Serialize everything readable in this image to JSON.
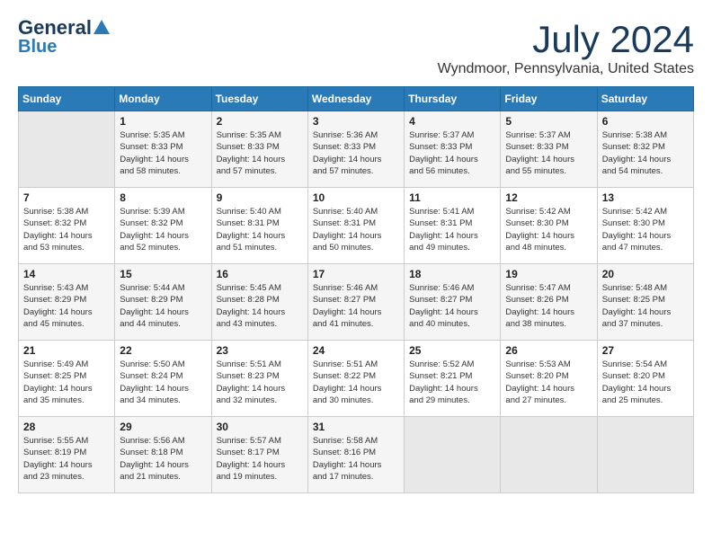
{
  "header": {
    "logo_line1": "General",
    "logo_line2": "Blue",
    "month": "July 2024",
    "location": "Wyndmoor, Pennsylvania, United States"
  },
  "weekdays": [
    "Sunday",
    "Monday",
    "Tuesday",
    "Wednesday",
    "Thursday",
    "Friday",
    "Saturday"
  ],
  "weeks": [
    [
      {
        "day": "",
        "sunrise": "",
        "sunset": "",
        "daylight": ""
      },
      {
        "day": "1",
        "sunrise": "Sunrise: 5:35 AM",
        "sunset": "Sunset: 8:33 PM",
        "daylight": "Daylight: 14 hours and 58 minutes."
      },
      {
        "day": "2",
        "sunrise": "Sunrise: 5:35 AM",
        "sunset": "Sunset: 8:33 PM",
        "daylight": "Daylight: 14 hours and 57 minutes."
      },
      {
        "day": "3",
        "sunrise": "Sunrise: 5:36 AM",
        "sunset": "Sunset: 8:33 PM",
        "daylight": "Daylight: 14 hours and 57 minutes."
      },
      {
        "day": "4",
        "sunrise": "Sunrise: 5:37 AM",
        "sunset": "Sunset: 8:33 PM",
        "daylight": "Daylight: 14 hours and 56 minutes."
      },
      {
        "day": "5",
        "sunrise": "Sunrise: 5:37 AM",
        "sunset": "Sunset: 8:33 PM",
        "daylight": "Daylight: 14 hours and 55 minutes."
      },
      {
        "day": "6",
        "sunrise": "Sunrise: 5:38 AM",
        "sunset": "Sunset: 8:32 PM",
        "daylight": "Daylight: 14 hours and 54 minutes."
      }
    ],
    [
      {
        "day": "7",
        "sunrise": "Sunrise: 5:38 AM",
        "sunset": "Sunset: 8:32 PM",
        "daylight": "Daylight: 14 hours and 53 minutes."
      },
      {
        "day": "8",
        "sunrise": "Sunrise: 5:39 AM",
        "sunset": "Sunset: 8:32 PM",
        "daylight": "Daylight: 14 hours and 52 minutes."
      },
      {
        "day": "9",
        "sunrise": "Sunrise: 5:40 AM",
        "sunset": "Sunset: 8:31 PM",
        "daylight": "Daylight: 14 hours and 51 minutes."
      },
      {
        "day": "10",
        "sunrise": "Sunrise: 5:40 AM",
        "sunset": "Sunset: 8:31 PM",
        "daylight": "Daylight: 14 hours and 50 minutes."
      },
      {
        "day": "11",
        "sunrise": "Sunrise: 5:41 AM",
        "sunset": "Sunset: 8:31 PM",
        "daylight": "Daylight: 14 hours and 49 minutes."
      },
      {
        "day": "12",
        "sunrise": "Sunrise: 5:42 AM",
        "sunset": "Sunset: 8:30 PM",
        "daylight": "Daylight: 14 hours and 48 minutes."
      },
      {
        "day": "13",
        "sunrise": "Sunrise: 5:42 AM",
        "sunset": "Sunset: 8:30 PM",
        "daylight": "Daylight: 14 hours and 47 minutes."
      }
    ],
    [
      {
        "day": "14",
        "sunrise": "Sunrise: 5:43 AM",
        "sunset": "Sunset: 8:29 PM",
        "daylight": "Daylight: 14 hours and 45 minutes."
      },
      {
        "day": "15",
        "sunrise": "Sunrise: 5:44 AM",
        "sunset": "Sunset: 8:29 PM",
        "daylight": "Daylight: 14 hours and 44 minutes."
      },
      {
        "day": "16",
        "sunrise": "Sunrise: 5:45 AM",
        "sunset": "Sunset: 8:28 PM",
        "daylight": "Daylight: 14 hours and 43 minutes."
      },
      {
        "day": "17",
        "sunrise": "Sunrise: 5:46 AM",
        "sunset": "Sunset: 8:27 PM",
        "daylight": "Daylight: 14 hours and 41 minutes."
      },
      {
        "day": "18",
        "sunrise": "Sunrise: 5:46 AM",
        "sunset": "Sunset: 8:27 PM",
        "daylight": "Daylight: 14 hours and 40 minutes."
      },
      {
        "day": "19",
        "sunrise": "Sunrise: 5:47 AM",
        "sunset": "Sunset: 8:26 PM",
        "daylight": "Daylight: 14 hours and 38 minutes."
      },
      {
        "day": "20",
        "sunrise": "Sunrise: 5:48 AM",
        "sunset": "Sunset: 8:25 PM",
        "daylight": "Daylight: 14 hours and 37 minutes."
      }
    ],
    [
      {
        "day": "21",
        "sunrise": "Sunrise: 5:49 AM",
        "sunset": "Sunset: 8:25 PM",
        "daylight": "Daylight: 14 hours and 35 minutes."
      },
      {
        "day": "22",
        "sunrise": "Sunrise: 5:50 AM",
        "sunset": "Sunset: 8:24 PM",
        "daylight": "Daylight: 14 hours and 34 minutes."
      },
      {
        "day": "23",
        "sunrise": "Sunrise: 5:51 AM",
        "sunset": "Sunset: 8:23 PM",
        "daylight": "Daylight: 14 hours and 32 minutes."
      },
      {
        "day": "24",
        "sunrise": "Sunrise: 5:51 AM",
        "sunset": "Sunset: 8:22 PM",
        "daylight": "Daylight: 14 hours and 30 minutes."
      },
      {
        "day": "25",
        "sunrise": "Sunrise: 5:52 AM",
        "sunset": "Sunset: 8:21 PM",
        "daylight": "Daylight: 14 hours and 29 minutes."
      },
      {
        "day": "26",
        "sunrise": "Sunrise: 5:53 AM",
        "sunset": "Sunset: 8:20 PM",
        "daylight": "Daylight: 14 hours and 27 minutes."
      },
      {
        "day": "27",
        "sunrise": "Sunrise: 5:54 AM",
        "sunset": "Sunset: 8:20 PM",
        "daylight": "Daylight: 14 hours and 25 minutes."
      }
    ],
    [
      {
        "day": "28",
        "sunrise": "Sunrise: 5:55 AM",
        "sunset": "Sunset: 8:19 PM",
        "daylight": "Daylight: 14 hours and 23 minutes."
      },
      {
        "day": "29",
        "sunrise": "Sunrise: 5:56 AM",
        "sunset": "Sunset: 8:18 PM",
        "daylight": "Daylight: 14 hours and 21 minutes."
      },
      {
        "day": "30",
        "sunrise": "Sunrise: 5:57 AM",
        "sunset": "Sunset: 8:17 PM",
        "daylight": "Daylight: 14 hours and 19 minutes."
      },
      {
        "day": "31",
        "sunrise": "Sunrise: 5:58 AM",
        "sunset": "Sunset: 8:16 PM",
        "daylight": "Daylight: 14 hours and 17 minutes."
      },
      {
        "day": "",
        "sunrise": "",
        "sunset": "",
        "daylight": ""
      },
      {
        "day": "",
        "sunrise": "",
        "sunset": "",
        "daylight": ""
      },
      {
        "day": "",
        "sunrise": "",
        "sunset": "",
        "daylight": ""
      }
    ]
  ]
}
